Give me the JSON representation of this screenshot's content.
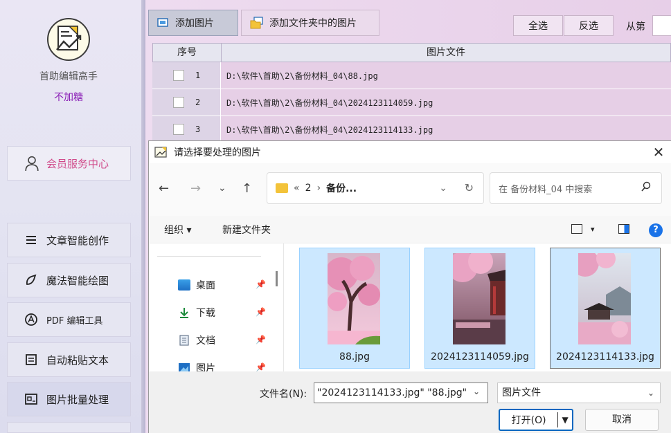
{
  "sidebar": {
    "app_name": "首助编辑高手",
    "app_subtitle": "不加糖",
    "member_center": "会员服务中心",
    "items": [
      {
        "label": "文章智能创作",
        "icon": "menu-lines-icon"
      },
      {
        "label": "魔法智能绘图",
        "icon": "magic-pen-icon"
      },
      {
        "label": "PDF 编辑工具",
        "icon": "pdf-icon"
      },
      {
        "label": "自动粘贴文本",
        "icon": "paste-icon"
      },
      {
        "label": "图片批量处理",
        "icon": "image-batch-icon"
      }
    ]
  },
  "toolbar": {
    "add_images": "添加图片",
    "add_folder_images": "添加文件夹中的图片",
    "select_all": "全选",
    "invert_selection": "反选",
    "from_label": "从第"
  },
  "table": {
    "headers": [
      "序号",
      "图片文件"
    ],
    "rows": [
      {
        "index": "1",
        "path": "D:\\软件\\首助\\2\\备份材料_04\\88.jpg"
      },
      {
        "index": "2",
        "path": "D:\\软件\\首助\\2\\备份材料_04\\2024123114059.jpg"
      },
      {
        "index": "3",
        "path": "D:\\软件\\首助\\2\\备份材料_04\\2024123114133.jpg"
      }
    ]
  },
  "dialog": {
    "title": "请选择要处理的图片",
    "address": {
      "prefix": "«",
      "segment1": "2",
      "separator": "›",
      "segment2": "备份..."
    },
    "search_placeholder": "在 备份材料_04 中搜索",
    "organize": "组织 ▾",
    "new_folder": "新建文件夹",
    "quick_access": [
      {
        "label": "桌面",
        "icon": "desktop-icon"
      },
      {
        "label": "下载",
        "icon": "download-icon"
      },
      {
        "label": "文档",
        "icon": "document-icon"
      },
      {
        "label": "图片",
        "icon": "pictures-icon"
      }
    ],
    "files": [
      {
        "name": "88.jpg"
      },
      {
        "name": "2024123114059.jpg"
      },
      {
        "name": "2024123114133.jpg"
      }
    ],
    "filename_label": "文件名(N):",
    "filename_value": "\"2024123114133.jpg\" \"88.jpg\"",
    "filetype": "图片文件",
    "open_label": "打开(O)",
    "cancel_label": "取消"
  },
  "colors": {
    "accent": "#0067c0",
    "subtitle": "#8a1fb6",
    "member": "#d04a8a",
    "selection": "#cce8ff"
  }
}
